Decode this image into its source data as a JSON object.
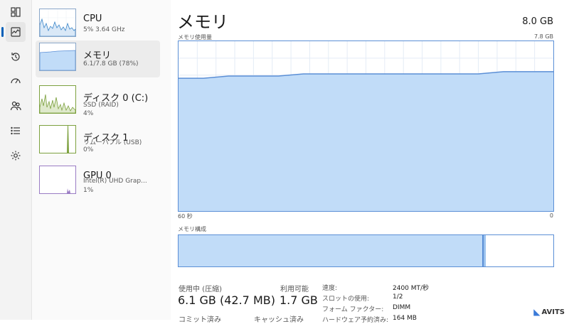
{
  "rail": {
    "icons": [
      "processes-icon",
      "performance-icon",
      "app-history-icon",
      "startup-apps-icon",
      "users-icon",
      "details-icon",
      "services-icon"
    ]
  },
  "devices": [
    {
      "name": "CPU",
      "line1": "5%  3.64 GHz",
      "line2": ""
    },
    {
      "name": "メモリ",
      "line1": "6.1/7.8 GB (78%)",
      "line2": ""
    },
    {
      "name": "ディスク 0 (C:)",
      "line1": "SSD (RAID)",
      "line2": "4%"
    },
    {
      "name": "ディスク 1",
      "line1": "リムーバブル (USB)",
      "line2": "0%"
    },
    {
      "name": "GPU 0",
      "line1": "Intel(R) UHD Grap...",
      "line2": "1%"
    }
  ],
  "main": {
    "title": "メモリ",
    "total": "8.0 GB",
    "usage_label": "メモリ使用量",
    "usage_max": "7.8 GB",
    "time_left": "60 秒",
    "time_right": "0",
    "composition_label": "メモリ構成",
    "composition_used_fraction": 0.78
  },
  "chart_data": {
    "type": "area",
    "title": "メモリ使用量",
    "xlabel": "",
    "ylabel": "",
    "x": [
      60,
      56,
      52,
      48,
      44,
      40,
      36,
      32,
      28,
      24,
      20,
      16,
      12,
      8,
      4,
      0
    ],
    "series": [
      {
        "values": [
          6.1,
          6.1,
          6.2,
          6.2,
          6.2,
          6.3,
          6.3,
          6.3,
          6.3,
          6.3,
          6.3,
          6.3,
          6.3,
          6.4,
          6.4,
          6.4
        ]
      }
    ],
    "xlim": [
      60,
      0
    ],
    "ylim": [
      0,
      7.8
    ],
    "grid": true
  },
  "stats": {
    "in_use_label": "使用中 (圧縮)",
    "in_use_value": "6.1 GB (42.7 MB)",
    "available_label": "利用可能",
    "available_value": "1.7 GB",
    "committed_label": "コミット済み",
    "cached_label": "キャッシュ済み"
  },
  "properties": [
    {
      "key": "速度:",
      "value": "2400 MT/秒"
    },
    {
      "key": "スロットの使用:",
      "value": "1/2"
    },
    {
      "key": "フォーム ファクター:",
      "value": "DIMM"
    },
    {
      "key": "ハードウェア予約済み:",
      "value": "164 MB"
    }
  ],
  "watermark": "AVITS",
  "colors": {
    "accent": "#005fb8",
    "memory_line": "#5b8fd6",
    "memory_fill": "#c1dcf8",
    "disk": "#7da13f",
    "gpu": "#9a7cc4"
  }
}
